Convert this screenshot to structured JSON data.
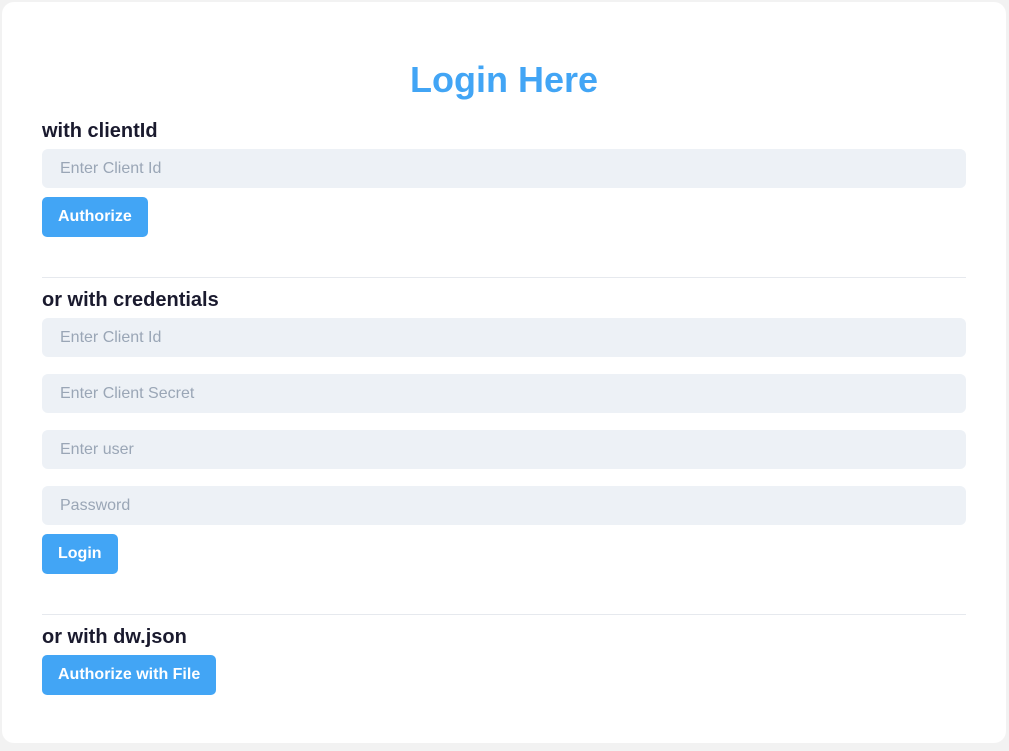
{
  "page": {
    "title": "Login Here"
  },
  "client_id_section": {
    "heading": "with clientId",
    "client_id_placeholder": "Enter Client Id",
    "authorize_label": "Authorize"
  },
  "credentials_section": {
    "heading": "or with credentials",
    "client_id_placeholder": "Enter Client Id",
    "client_secret_placeholder": "Enter Client Secret",
    "user_placeholder": "Enter user",
    "password_placeholder": "Password",
    "login_label": "Login"
  },
  "file_section": {
    "heading": "or with dw.json",
    "authorize_file_label": "Authorize with File"
  },
  "colors": {
    "accent": "#42a5f5",
    "input_background": "#edf1f6",
    "heading_text": "#1a1a2e",
    "placeholder_text": "#9aa6b6"
  }
}
